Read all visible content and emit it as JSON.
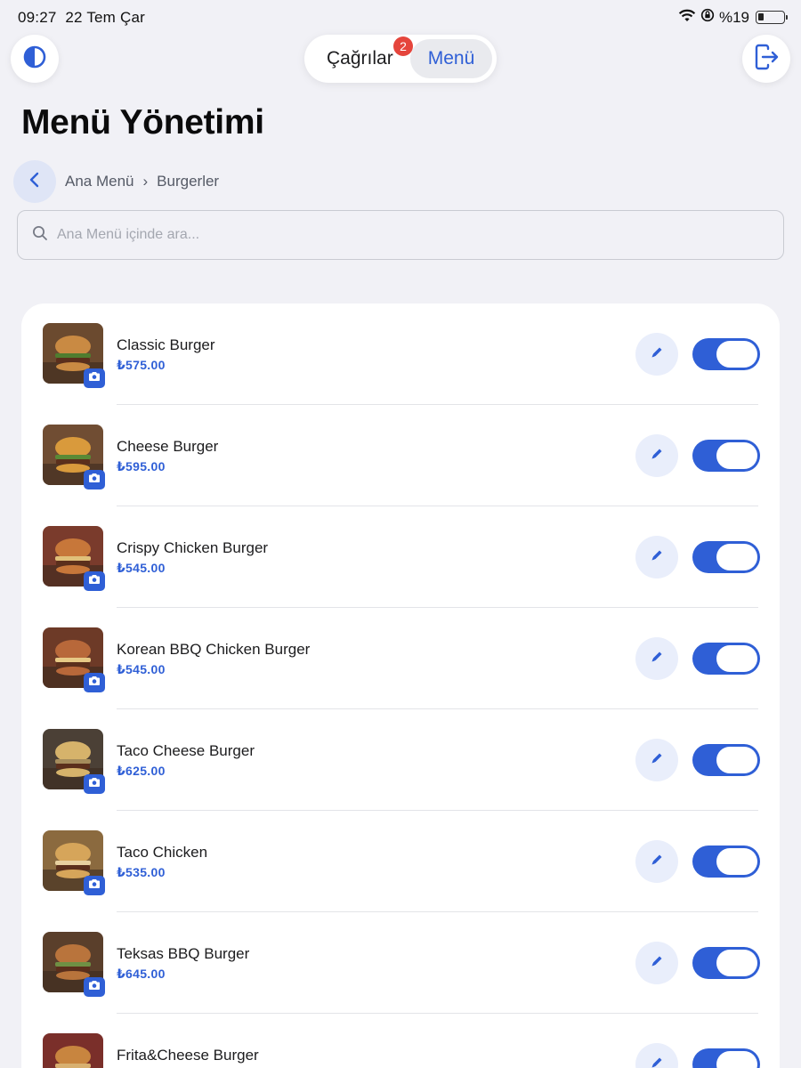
{
  "status_bar": {
    "time": "09:27",
    "date": "22 Tem Çar",
    "battery": "%19",
    "battery_level": 0.19
  },
  "header": {
    "theme_icon": "contrast-icon",
    "logout_icon": "logout-icon",
    "tabs": {
      "calls_label": "Çağrılar",
      "calls_badge": "2",
      "menu_label": "Menü",
      "active": "menu"
    }
  },
  "page": {
    "title": "Menü Yönetimi"
  },
  "breadcrumb": {
    "items": [
      "Ana Menü",
      "Burgerler"
    ],
    "separator": "›"
  },
  "search": {
    "placeholder": "Ana Menü içinde ara...",
    "value": ""
  },
  "colors": {
    "accent": "#2f5fd6",
    "badge": "#e5453c",
    "background": "#f1f1f6"
  },
  "items": [
    {
      "name": "Classic Burger",
      "price": "₺575.00",
      "enabled": true
    },
    {
      "name": "Cheese Burger",
      "price": "₺595.00",
      "enabled": true
    },
    {
      "name": "Crispy Chicken Burger",
      "price": "₺545.00",
      "enabled": true
    },
    {
      "name": "Korean BBQ Chicken Burger",
      "price": "₺545.00",
      "enabled": true
    },
    {
      "name": "Taco Cheese Burger",
      "price": "₺625.00",
      "enabled": true
    },
    {
      "name": "Taco Chicken",
      "price": "₺535.00",
      "enabled": true
    },
    {
      "name": "Teksas BBQ Burger",
      "price": "₺645.00",
      "enabled": true
    },
    {
      "name": "Frita&Cheese Burger",
      "price": "",
      "enabled": true
    }
  ]
}
